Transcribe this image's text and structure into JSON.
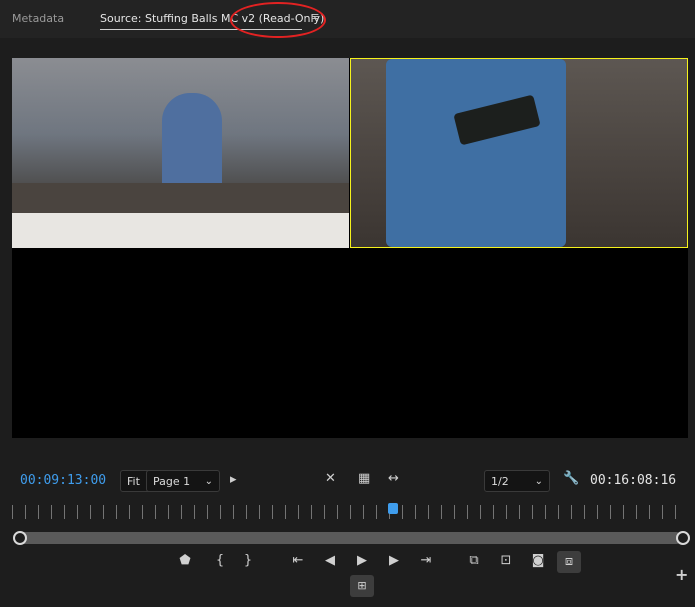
{
  "tabs": {
    "metadata_label": "Metadata",
    "source_label": "Source: Stuffing Balls MC v2 (Read-Only)",
    "menu_icon": "hamburger-menu-icon"
  },
  "timecode": {
    "current": "00:09:13:00",
    "duration": "00:16:08:16"
  },
  "controls": {
    "fit_label": "Fit",
    "page_label": "Page 1",
    "ratio_label": "1/2"
  },
  "icons": {
    "settings": "wrench-icon",
    "add": "plus-icon"
  },
  "colors": {
    "timecode_accent": "#3f9ded",
    "active_angle_border": "#f5f21c",
    "annotation_circle": "#e32222"
  }
}
